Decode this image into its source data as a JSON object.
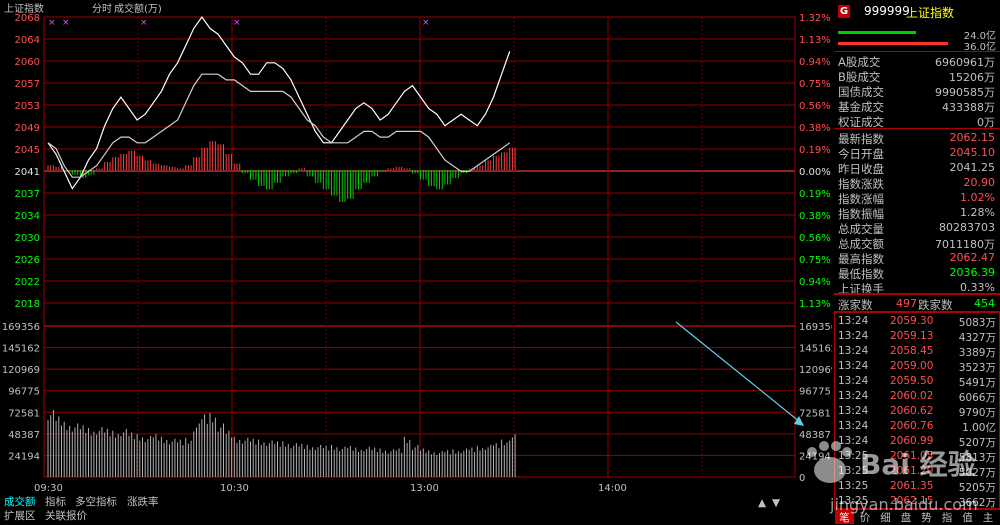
{
  "chart_header": {
    "index_name": "上证指数",
    "mode": "分时",
    "unit_label": "成交额(万)"
  },
  "price_axis": {
    "left_ticks": [
      "2068",
      "2064",
      "2060",
      "2057",
      "2053",
      "2049",
      "2045",
      "2041",
      "2037",
      "2034",
      "2030",
      "2026",
      "2022",
      "2018"
    ],
    "right_ticks": [
      "1.32%",
      "1.13%",
      "0.94%",
      "0.75%",
      "0.56%",
      "0.38%",
      "0.19%",
      "0.00%",
      "0.19%",
      "0.38%",
      "0.56%",
      "0.75%",
      "0.94%",
      "1.13%"
    ],
    "prev_close": 2041.25
  },
  "volume_axis": {
    "left_ticks": [
      "169356",
      "145162",
      "120969",
      "96775",
      "72581",
      "48387",
      "24194"
    ],
    "right_ticks": [
      "169356",
      "145162",
      "120969",
      "96775",
      "72581",
      "48387",
      "24194",
      "0"
    ],
    "max": 169356
  },
  "time_axis": [
    "09:30",
    "10:30",
    "13:00",
    "14:00"
  ],
  "chart_data": {
    "type": "line",
    "x_label": "",
    "y_label": "",
    "ylim": [
      2018,
      2068
    ],
    "series": [
      {
        "name": "",
        "color": "#ffffff",
        "values": [
          2046,
          2044,
          2041,
          2038,
          2040,
          2043,
          2045,
          2049,
          2052,
          2054,
          2052,
          2050,
          2051,
          2053,
          2055,
          2058,
          2060,
          2063,
          2066,
          2068,
          2066,
          2065,
          2063,
          2061,
          2060,
          2058,
          2058,
          2060,
          2060,
          2059,
          2057,
          2054,
          2051,
          2048,
          2046,
          2046,
          2048,
          2050,
          2052,
          2053,
          2052,
          2050,
          2051,
          2053,
          2055,
          2056,
          2054,
          2052,
          2051,
          2049,
          2050,
          2051,
          2050,
          2049,
          2051,
          2054,
          2058,
          2062
        ]
      },
      {
        "name": "",
        "color": "#d0d0d0",
        "values": [
          2046,
          2045,
          2042,
          2040,
          2040,
          2041,
          2042,
          2044,
          2046,
          2047,
          2047,
          2046,
          2046,
          2047,
          2048,
          2049,
          2050,
          2053,
          2056,
          2058,
          2058,
          2058,
          2057,
          2057,
          2056,
          2055,
          2055,
          2055,
          2055,
          2055,
          2054,
          2052,
          2050,
          2049,
          2047,
          2046,
          2046,
          2046,
          2047,
          2048,
          2048,
          2047,
          2047,
          2048,
          2048,
          2048,
          2048,
          2047,
          2045,
          2043,
          2042,
          2041,
          2041,
          2042,
          2043,
          2044,
          2045,
          2046
        ]
      }
    ],
    "breadth_bars": [
      3,
      2,
      -1,
      -3,
      -5,
      -3,
      1,
      5,
      8,
      10,
      12,
      9,
      6,
      4,
      3,
      2,
      1,
      3,
      8,
      14,
      18,
      16,
      10,
      4,
      -2,
      -6,
      -10,
      -12,
      -8,
      -4,
      -2,
      1,
      -4,
      -8,
      -12,
      -16,
      -20,
      -18,
      -12,
      -8,
      -4,
      -1,
      1,
      2,
      1,
      -2,
      -6,
      -10,
      -12,
      -9,
      -5,
      -2,
      1,
      3,
      6,
      9,
      11,
      14
    ],
    "volumes": [
      75000,
      68000,
      62000,
      60000,
      58000,
      55000,
      56000,
      54000,
      52000,
      54000,
      50000,
      48000,
      46000,
      48000,
      45000,
      43000,
      42000,
      44000,
      60000,
      70000,
      72000,
      60000,
      52000,
      45000,
      44000,
      43000,
      42000,
      41000,
      40000,
      40000,
      38000,
      37000,
      36000,
      36000,
      35000,
      36000,
      34000,
      35000,
      33000,
      34000,
      33000,
      32000,
      31000,
      32000,
      45000,
      36000,
      32000,
      30000,
      29000,
      30000,
      31000,
      32000,
      33000,
      35000,
      36000,
      38000,
      42000,
      48000
    ]
  },
  "quote_panel": {
    "flag": "G",
    "code": "999999",
    "name": "上证指数",
    "buy_bar_value": "24.0亿",
    "sell_bar_value": "36.0亿",
    "buy_bar_color": "#00cc00",
    "sell_bar_color": "#ff3030",
    "stats": [
      {
        "label": "A股成交",
        "value": "6960961万",
        "color": "#c0c0c0"
      },
      {
        "label": "B股成交",
        "value": "15206万",
        "color": "#c0c0c0"
      },
      {
        "label": "国债成交",
        "value": "9990585万",
        "color": "#c0c0c0"
      },
      {
        "label": "基金成交",
        "value": "433388万",
        "color": "#c0c0c0"
      },
      {
        "label": "权证成交",
        "value": "0万",
        "color": "#c0c0c0"
      }
    ],
    "index_stats": [
      {
        "label": "最新指数",
        "value": "2062.15",
        "color": "#ff5050"
      },
      {
        "label": "今日开盘",
        "value": "2045.10",
        "color": "#ff5050"
      },
      {
        "label": "昨日收盘",
        "value": "2041.25",
        "color": "#c0c0c0"
      },
      {
        "label": "指数涨跌",
        "value": "20.90",
        "color": "#ff5050"
      },
      {
        "label": "指数涨幅",
        "value": "1.02%",
        "color": "#ff5050"
      },
      {
        "label": "指数振幅",
        "value": "1.28%",
        "color": "#c0c0c0"
      },
      {
        "label": "总成交量",
        "value": "80283703",
        "color": "#c0c0c0"
      },
      {
        "label": "总成交额",
        "value": "7011180万",
        "color": "#c0c0c0"
      },
      {
        "label": "最高指数",
        "value": "2062.47",
        "color": "#ff5050"
      },
      {
        "label": "最低指数",
        "value": "2036.39",
        "color": "#00ff00"
      },
      {
        "label": "上证换手",
        "value": "0.33%",
        "color": "#c0c0c0"
      }
    ],
    "breadth": {
      "up_label": "涨家数",
      "up_value": "497",
      "down_label": "跌家数",
      "down_value": "454"
    },
    "ticks": [
      {
        "time": "13:24",
        "price": "2059.30",
        "vol": "5083万"
      },
      {
        "time": "13:24",
        "price": "2059.13",
        "vol": "4327万"
      },
      {
        "time": "13:24",
        "price": "2058.45",
        "vol": "3389万"
      },
      {
        "time": "13:24",
        "price": "2059.00",
        "vol": "3523万"
      },
      {
        "time": "13:24",
        "price": "2059.50",
        "vol": "5491万"
      },
      {
        "time": "13:24",
        "price": "2060.02",
        "vol": "6066万"
      },
      {
        "time": "13:24",
        "price": "2060.62",
        "vol": "9790万"
      },
      {
        "time": "13:24",
        "price": "2060.76",
        "vol": "1.00亿"
      },
      {
        "time": "13:24",
        "price": "2060.99",
        "vol": "5207万"
      },
      {
        "time": "13:25",
        "price": "2061.05",
        "vol": "5813万"
      },
      {
        "time": "13:25",
        "price": "2061.20",
        "vol": "5027万"
      },
      {
        "time": "13:25",
        "price": "2061.35",
        "vol": "5205万"
      },
      {
        "time": "13:25",
        "price": "2062.15",
        "vol": "3662万"
      }
    ],
    "tabs": [
      "笔",
      "价",
      "细",
      "盘",
      "势",
      "指",
      "值",
      "主"
    ]
  },
  "bottom_tabs_row1": [
    "成交额",
    "指标",
    "多空指标",
    "涨跌率"
  ],
  "bottom_tabs_row2": [
    "扩展区",
    "关联报价"
  ],
  "scroll_buttons": [
    "▲",
    "▼"
  ],
  "watermark": {
    "text": "Bai 经验",
    "url": "jingyan.baidu.com"
  }
}
